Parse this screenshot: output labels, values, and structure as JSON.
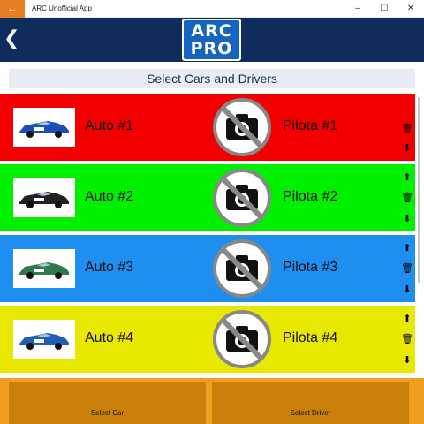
{
  "window": {
    "title": "ARC Unofficial App",
    "min_icon": "minimize-icon",
    "max_icon": "maximize-icon",
    "close_icon": "close-icon"
  },
  "header": {
    "logo_line1": "ARC",
    "logo_line2": "PRO",
    "back_icon": "back-icon"
  },
  "page": {
    "subtitle": "Select Cars and Drivers"
  },
  "rows": [
    {
      "car_label": "Auto #1",
      "pilot_label": "Pilota #1",
      "bg": "#f20000",
      "car_color": "#1a4fb5",
      "controls": [
        "delete",
        "down"
      ]
    },
    {
      "car_label": "Auto #2",
      "pilot_label": "Pilota #2",
      "bg": "#00f000",
      "car_color": "#222222",
      "controls": [
        "up",
        "delete",
        "down"
      ]
    },
    {
      "car_label": "Auto #3",
      "pilot_label": "Pilota #3",
      "bg": "#1e8ef0",
      "car_color": "#2d7a4a",
      "controls": [
        "up",
        "delete",
        "down"
      ]
    },
    {
      "car_label": "Auto #4",
      "pilot_label": "Pilota #4",
      "bg": "#e8e800",
      "car_color": "#1f5fb8",
      "controls": [
        "up",
        "delete",
        "down"
      ]
    }
  ],
  "footer": {
    "select_car": "Select Car",
    "select_driver": "Select Driver"
  },
  "colors": {
    "header": "#0e2d5c",
    "logo": "#1565c0",
    "footer": "#f0a020",
    "footer_button": "#c97f0a"
  }
}
